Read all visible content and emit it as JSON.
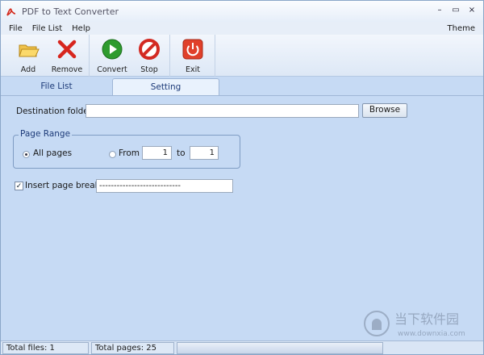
{
  "window": {
    "title": "PDF to Text Converter"
  },
  "window_controls": {
    "minimize": "–",
    "maximize": "▭",
    "close": "×"
  },
  "menu": {
    "file": "File",
    "file_list": "File List",
    "help": "Help",
    "theme": "Theme"
  },
  "toolbar": {
    "add": "Add",
    "remove": "Remove",
    "convert": "Convert",
    "stop": "Stop",
    "exit": "Exit"
  },
  "tabs": {
    "file_list": "File List",
    "setting": "Setting"
  },
  "settings": {
    "destination_label": "Destination folder:",
    "destination_value": "",
    "browse": "Browse",
    "page_range_title": "Page Range",
    "all_pages": "All pages",
    "from_label": "From",
    "from_value": "1",
    "to_label": "to",
    "to_value": "1",
    "page_breaks_label": "Insert page breaks:",
    "page_breaks_value": "----------------------------",
    "page_breaks_checked": true
  },
  "status": {
    "total_files": "Total files: 1",
    "total_pages": "Total pages: 25"
  },
  "watermark": {
    "cn": "当下软件园",
    "url": "www.downxia.com"
  },
  "colors": {
    "background": "#c6daf4",
    "accent": "#1c3a78"
  }
}
